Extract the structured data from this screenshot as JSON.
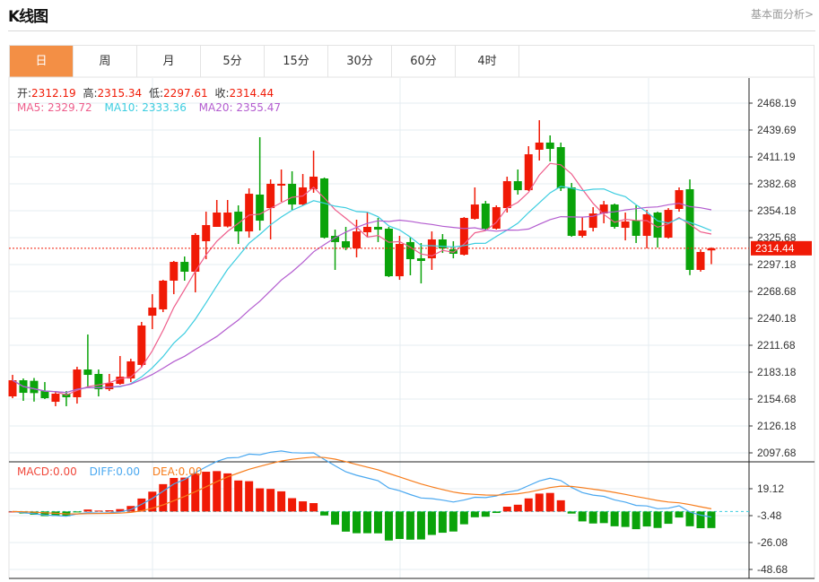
{
  "header": {
    "title": "K线图",
    "link": "基本面分析>"
  },
  "tabs": [
    {
      "label": "日",
      "active": true
    },
    {
      "label": "周"
    },
    {
      "label": "月"
    },
    {
      "label": "5分"
    },
    {
      "label": "15分"
    },
    {
      "label": "30分"
    },
    {
      "label": "60分"
    },
    {
      "label": "4时"
    }
  ],
  "ohlc_legend": {
    "open_label": "开:",
    "open": "2312.19",
    "high_label": "高:",
    "high": "2315.34",
    "low_label": "低:",
    "low": "2297.61",
    "close_label": "收:",
    "close": "2314.44"
  },
  "ma_legend": {
    "ma5": "MA5: 2329.72",
    "ma10": "MA10: 2333.36",
    "ma20": "MA20: 2355.47"
  },
  "macd_legend": {
    "macd": "MACD:0.00",
    "diff": "DIFF:0.00",
    "dea": "DEA:0.00"
  },
  "colors": {
    "up": "#f01a06",
    "down": "#0aa30a",
    "ma5": "#ee5d8b",
    "ma10": "#3ccde0",
    "ma20": "#b35ccf",
    "diff": "#4aa8f0",
    "dea": "#f77d1c",
    "active_tab": "#f38f45"
  },
  "current_price": "2314.44",
  "chart_data": {
    "type": "candlestick",
    "price_ticks": [
      "2468.19",
      "2439.69",
      "2411.19",
      "2382.68",
      "2354.18",
      "2325.68",
      "2297.18",
      "2268.68",
      "2240.18",
      "2211.68",
      "2183.18",
      "2154.68",
      "2126.18",
      "2097.68"
    ],
    "price_range": [
      2097.68,
      2468.19
    ],
    "macd_ticks": [
      "19.12",
      "-3.48",
      "-26.08",
      "-48.68"
    ],
    "macd_range": [
      -48.68,
      19.12
    ],
    "ohlc": [
      [
        2157.5,
        2180.3,
        2155.6,
        2174.6
      ],
      [
        2174.6,
        2176.5,
        2152.8,
        2161.3
      ],
      [
        2174.0,
        2177.0,
        2152.0,
        2161.0
      ],
      [
        2163.2,
        2172.7,
        2154.7,
        2155.6
      ],
      [
        2151.8,
        2163.2,
        2147.1,
        2160.4
      ],
      [
        2160.4,
        2163.2,
        2147.1,
        2156.6
      ],
      [
        2156.6,
        2188.9,
        2149.9,
        2186.0
      ],
      [
        2186.0,
        2223.1,
        2166.1,
        2180.3
      ],
      [
        2181.3,
        2186.0,
        2157.5,
        2165.1
      ],
      [
        2165.1,
        2181.3,
        2163.2,
        2171.8
      ],
      [
        2170.8,
        2200.3,
        2169.9,
        2178.4
      ],
      [
        2176.5,
        2197.4,
        2172.7,
        2194.6
      ],
      [
        2190.8,
        2236.4,
        2187.9,
        2232.6
      ],
      [
        2243.0,
        2265.8,
        2228.8,
        2251.6
      ],
      [
        2249.7,
        2281.0,
        2246.8,
        2280.1
      ],
      [
        2280.1,
        2301.0,
        2265.8,
        2300.0
      ],
      [
        2300.0,
        2305.7,
        2280.1,
        2289.6
      ],
      [
        2289.6,
        2330.4,
        2267.7,
        2328.5
      ],
      [
        2321.9,
        2353.2,
        2302.9,
        2339.0
      ],
      [
        2337.1,
        2365.6,
        2337.1,
        2352.3
      ],
      [
        2337.5,
        2365.6,
        2336.5,
        2352.3
      ],
      [
        2353.2,
        2359.9,
        2319.0,
        2332.3
      ],
      [
        2332.3,
        2377.9,
        2325.7,
        2372.2
      ],
      [
        2371.3,
        2432.1,
        2333.3,
        2343.7
      ],
      [
        2357.0,
        2387.4,
        2323.8,
        2382.7
      ],
      [
        2380.8,
        2397.9,
        2363.7,
        2382.7
      ],
      [
        2382.7,
        2396.0,
        2355.1,
        2360.8
      ],
      [
        2360.8,
        2393.1,
        2360.0,
        2378.9
      ],
      [
        2377.0,
        2417.8,
        2373.2,
        2390.3
      ],
      [
        2388.4,
        2389.4,
        2324.7,
        2325.7
      ],
      [
        2327.6,
        2334.2,
        2291.5,
        2321.0
      ],
      [
        2321.9,
        2337.1,
        2312.4,
        2315.2
      ],
      [
        2314.3,
        2344.7,
        2304.8,
        2332.3
      ],
      [
        2331.4,
        2352.3,
        2326.6,
        2337.1
      ],
      [
        2337.1,
        2346.6,
        2321.0,
        2334.2
      ],
      [
        2335.2,
        2337.1,
        2283.9,
        2284.8
      ],
      [
        2284.8,
        2327.6,
        2281.0,
        2319.0
      ],
      [
        2321.0,
        2326.6,
        2285.8,
        2302.9
      ],
      [
        2303.8,
        2320.0,
        2277.2,
        2301.0
      ],
      [
        2303.8,
        2332.3,
        2291.5,
        2323.8
      ],
      [
        2323.8,
        2329.5,
        2309.5,
        2314.3
      ],
      [
        2313.3,
        2321.9,
        2303.8,
        2308.6
      ],
      [
        2307.6,
        2347.5,
        2306.7,
        2346.6
      ],
      [
        2345.6,
        2378.9,
        2344.7,
        2360.8
      ],
      [
        2361.8,
        2364.6,
        2334.2,
        2335.2
      ],
      [
        2335.2,
        2359.9,
        2334.2,
        2358.0
      ],
      [
        2357.0,
        2390.3,
        2352.3,
        2385.5
      ],
      [
        2385.5,
        2397.9,
        2371.3,
        2376.0
      ],
      [
        2376.0,
        2422.6,
        2375.1,
        2414.0
      ],
      [
        2418.8,
        2450.1,
        2407.4,
        2426.4
      ],
      [
        2426.4,
        2434.0,
        2406.4,
        2419.7
      ],
      [
        2421.6,
        2426.4,
        2375.1,
        2377.9
      ],
      [
        2378.9,
        2383.6,
        2326.6,
        2327.6
      ],
      [
        2327.6,
        2347.5,
        2325.7,
        2333.3
      ],
      [
        2336.1,
        2358.0,
        2332.3,
        2351.3
      ],
      [
        2351.3,
        2364.6,
        2340.9,
        2360.8
      ],
      [
        2360.8,
        2361.8,
        2335.2,
        2337.1
      ],
      [
        2336.1,
        2352.3,
        2322.8,
        2342.8
      ],
      [
        2343.7,
        2359.9,
        2320.0,
        2327.6
      ],
      [
        2327.6,
        2355.1,
        2314.3,
        2350.4
      ],
      [
        2352.3,
        2353.2,
        2315.2,
        2325.7
      ],
      [
        2325.7,
        2357.0,
        2324.7,
        2355.1
      ],
      [
        2356.1,
        2378.9,
        2353.2,
        2376.0
      ],
      [
        2377.0,
        2387.4,
        2286.0,
        2291.5
      ],
      [
        2291.5,
        2313.3,
        2289.7,
        2310.5
      ],
      [
        2312.19,
        2315.34,
        2297.61,
        2314.44
      ]
    ],
    "grid": true
  }
}
